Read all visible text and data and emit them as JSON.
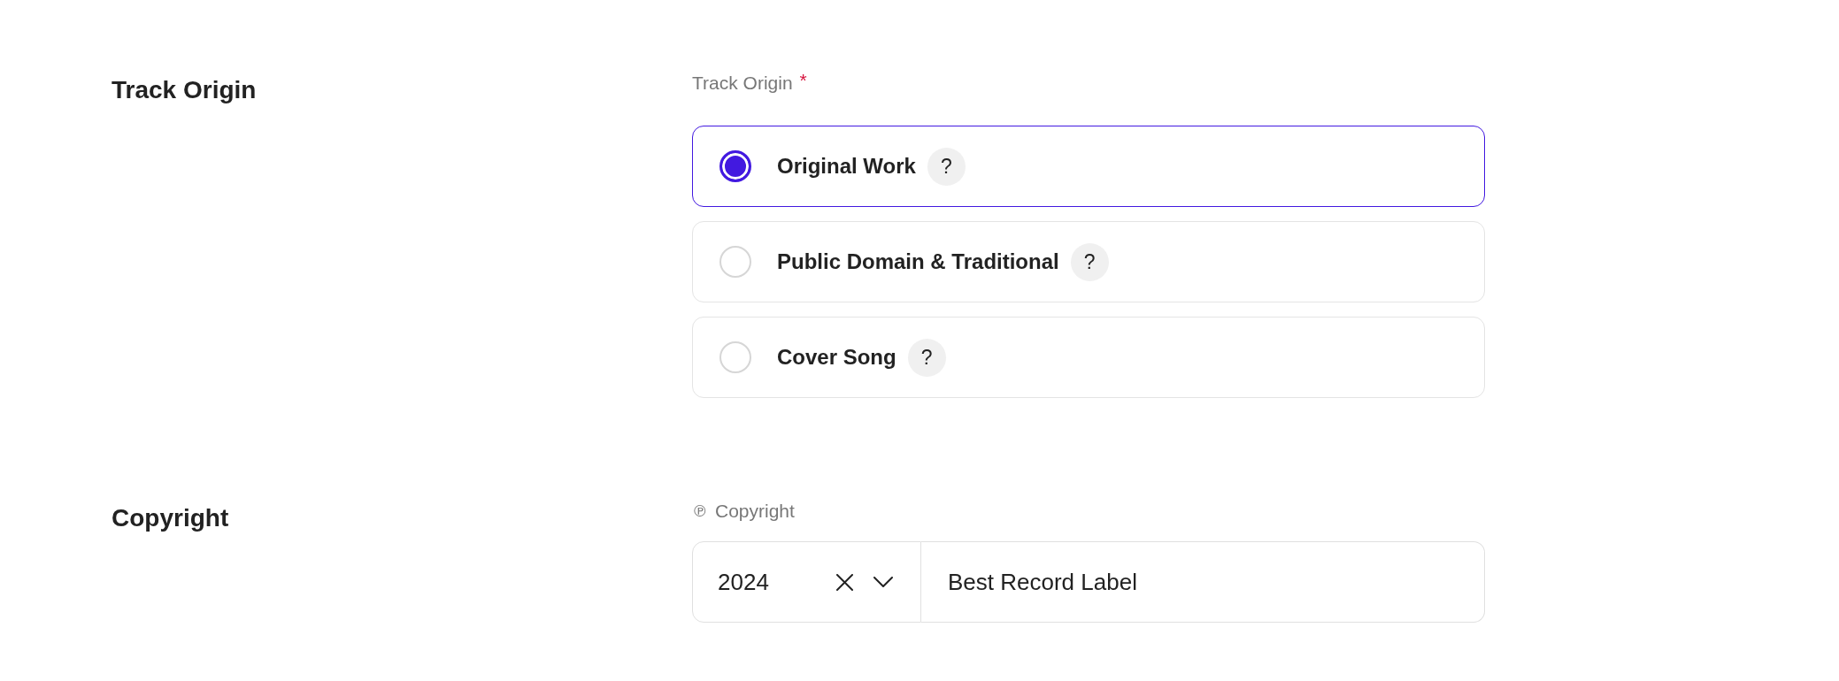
{
  "sections": [
    {
      "kind": "radio_group",
      "heading": "Track Origin",
      "label": "Track Origin",
      "required_mark": "*",
      "options": [
        {
          "label": "Original Work",
          "help": "?",
          "selected": true
        },
        {
          "label": "Public Domain & Traditional",
          "help": "?",
          "selected": false
        },
        {
          "label": "Cover Song",
          "help": "?",
          "selected": false
        }
      ]
    },
    {
      "kind": "copyright",
      "heading": "Copyright",
      "label_symbol": "℗",
      "label": "Copyright",
      "year": "2024",
      "owner": "Best Record Label"
    }
  ]
}
